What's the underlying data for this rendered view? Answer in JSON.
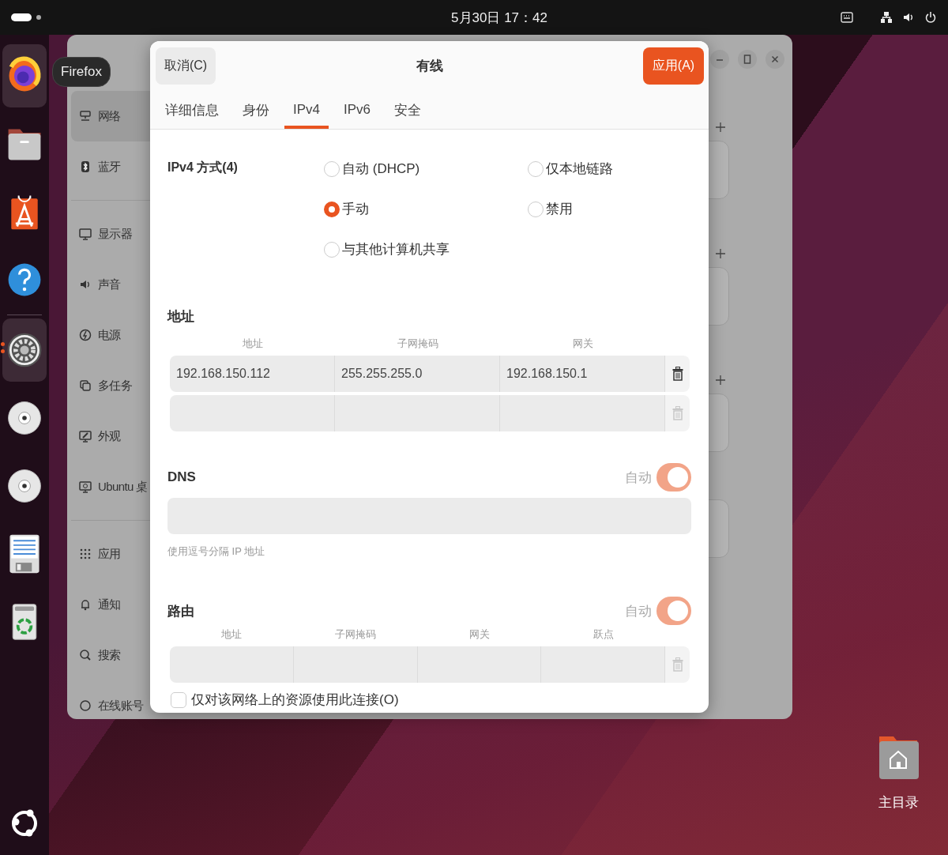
{
  "top_bar": {
    "clock": "5月30日 17：42"
  },
  "dock": {
    "items": [
      {
        "kind": "browser",
        "active": true,
        "running": false
      },
      {
        "kind": "folder",
        "active": false,
        "running": false
      },
      {
        "kind": "store",
        "active": false,
        "running": false
      },
      {
        "kind": "help",
        "active": false,
        "running": false
      },
      {
        "kind": "settings",
        "active": true,
        "running": true
      },
      {
        "kind": "disc",
        "active": false,
        "running": false
      },
      {
        "kind": "disc",
        "active": false,
        "running": false
      },
      {
        "kind": "document",
        "active": false,
        "running": false
      },
      {
        "kind": "trash",
        "active": false,
        "running": false
      }
    ]
  },
  "tooltip": {
    "text": "Firefox"
  },
  "settings_window": {
    "sidebar": {
      "groups": [
        [
          {
            "kind": "network",
            "label": "网络",
            "selected": true
          },
          {
            "kind": "bluetooth",
            "label": "蓝牙",
            "selected": false
          }
        ],
        [
          {
            "kind": "display",
            "label": "显示器",
            "selected": false
          },
          {
            "kind": "sound",
            "label": "声音",
            "selected": false
          },
          {
            "kind": "power",
            "label": "电源",
            "selected": false
          },
          {
            "kind": "multitask",
            "label": "多任务",
            "selected": false
          },
          {
            "kind": "appearance",
            "label": "外观",
            "selected": false
          },
          {
            "kind": "desktop",
            "label": "Ubuntu 桌",
            "selected": false
          }
        ],
        [
          {
            "kind": "apps",
            "label": "应用",
            "selected": false
          },
          {
            "kind": "bell",
            "label": "通知",
            "selected": false
          },
          {
            "kind": "search",
            "label": "搜索",
            "selected": false
          },
          {
            "kind": "accounts",
            "label": "在线账号",
            "selected": false
          }
        ]
      ]
    }
  },
  "dialog": {
    "cancel": "取消(C)",
    "title": "有线",
    "apply": "应用(A)",
    "tabs": [
      {
        "label": "详细信息",
        "selected": false
      },
      {
        "label": "身份",
        "selected": false
      },
      {
        "label": "IPv4",
        "selected": true
      },
      {
        "label": "IPv6",
        "selected": false
      },
      {
        "label": "安全",
        "selected": false
      }
    ],
    "method": {
      "label": "IPv4 方式(4)",
      "options": [
        {
          "label": "自动 (DHCP)",
          "selected": false
        },
        {
          "label": "仅本地链路",
          "selected": false
        },
        {
          "label": "手动",
          "selected": true
        },
        {
          "label": "禁用",
          "selected": false
        },
        {
          "label": "与其他计算机共享",
          "selected": false
        }
      ]
    },
    "addresses": {
      "title": "地址",
      "columns": [
        "地址",
        "子网掩码",
        "网关"
      ],
      "rows": [
        {
          "cells": [
            "192.168.150.112",
            "255.255.255.0",
            "192.168.150.1"
          ],
          "delete_disabled": false
        },
        {
          "delete_disabled": true
        }
      ]
    },
    "dns": {
      "title": "DNS",
      "auto_label": "自动",
      "auto_on": true,
      "hint": "使用逗号分隔 IP 地址"
    },
    "routes": {
      "title": "路由",
      "auto_label": "自动",
      "auto_on": true,
      "columns": [
        "地址",
        "子网掩码",
        "网关",
        "跃点"
      ],
      "rows": [
        {
          "delete_disabled": true
        }
      ]
    },
    "option": {
      "label": "仅对该网络上的资源使用此连接(O)",
      "checked": false
    }
  },
  "desktop_icons": [
    {
      "kind": "home",
      "label": "主目录"
    }
  ]
}
